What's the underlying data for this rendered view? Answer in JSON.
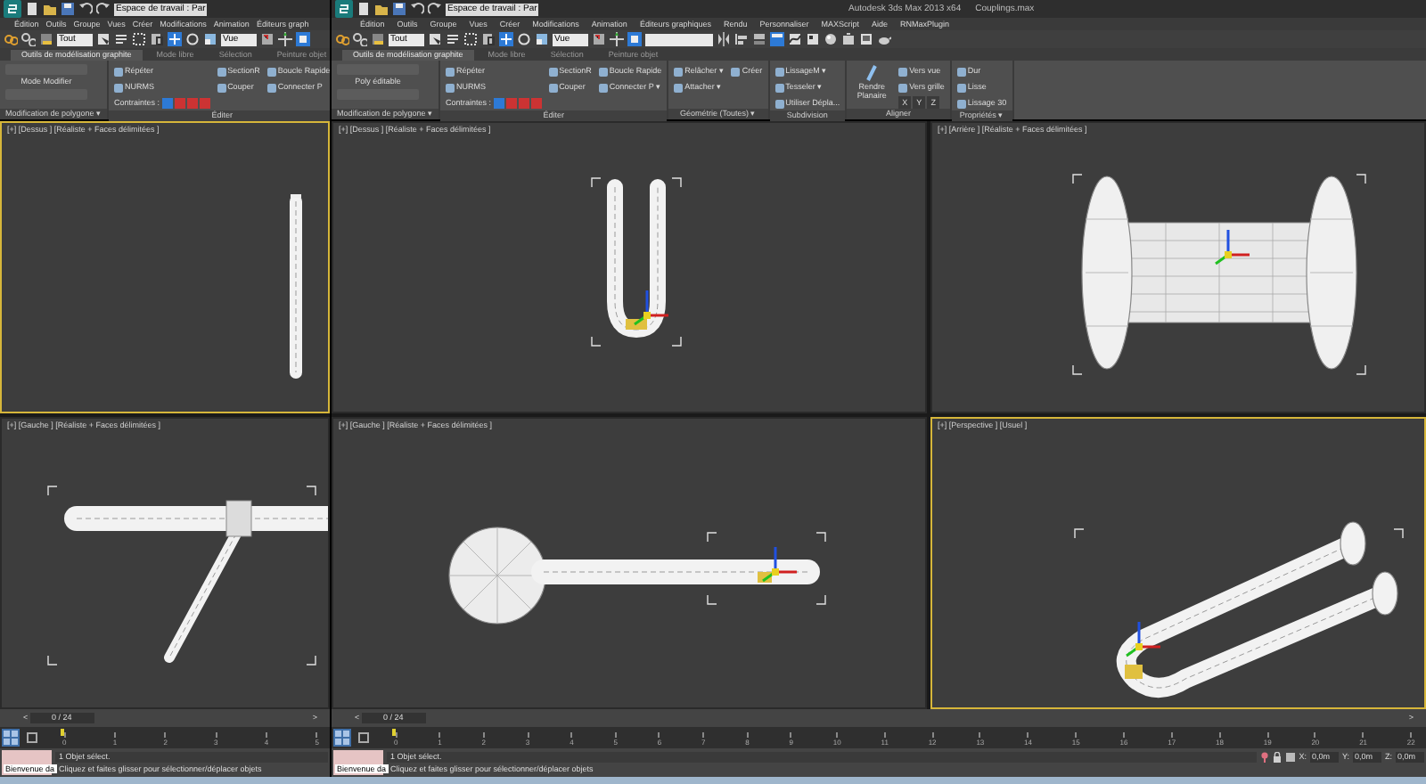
{
  "windows": [
    {
      "kind": "back",
      "workspace": "Espace de travail : Par",
      "menu": [
        "Édition",
        "Outils",
        "Groupe",
        "Vues",
        "Créer",
        "Modifications",
        "Animation",
        "Éditeurs graph"
      ],
      "toolbar": {
        "filter": "Tout",
        "reference": "Vue"
      },
      "ribbon_tabs": [
        {
          "label": "Outils de modélisation graphite",
          "selected": true
        },
        {
          "label": "Mode libre",
          "selected": false
        },
        {
          "label": "Sélection",
          "selected": false
        },
        {
          "label": "Peinture objet",
          "selected": false
        }
      ],
      "ribbon_panels": [
        {
          "footer": "Modification de polygone ▾",
          "columns": [
            [
              {
                "kind": "heading",
                "label": "Mode Modifier"
              }
            ]
          ]
        },
        {
          "footer": "Éditer",
          "columns": [
            [
              {
                "kind": "small",
                "label": "Répéter"
              },
              {
                "kind": "small",
                "label": "NURMS"
              },
              {
                "kind": "constraints",
                "label": "Contraintes :"
              }
            ],
            [
              {
                "kind": "small",
                "label": "SectionR"
              },
              {
                "kind": "small",
                "label": "Couper"
              }
            ],
            [
              {
                "kind": "small",
                "label": "Boucle Rapide"
              },
              {
                "kind": "small",
                "label": "Connecter P"
              }
            ]
          ]
        }
      ],
      "viewports": [
        {
          "label": "[+] [Dessus ] [Réaliste + Faces délimitées ]",
          "active": true,
          "kind": "rod"
        },
        {
          "label": "[+] [Gauche ] [Réaliste + Faces délimitées ]",
          "active": false,
          "kind": "bent_arm"
        }
      ],
      "time_slider": {
        "previous": "<",
        "value": "0 / 24",
        "next": ">"
      },
      "ticks": [
        "0",
        "1",
        "2",
        "3",
        "4",
        "5"
      ],
      "status": {
        "script": "Bienvenue da",
        "selection": "1 Objet sélect.",
        "prompt": "Cliquez et faites glisser pour sélectionner/déplacer objets"
      }
    },
    {
      "kind": "main",
      "workspace": "Espace de travail : Par",
      "title": "Autodesk 3ds Max 2013 x64",
      "file": "Couplings.max",
      "menu": [
        "Édition",
        "Outils",
        "Groupe",
        "Vues",
        "Créer",
        "Modifications",
        "Animation",
        "Éditeurs graphiques",
        "Rendu",
        "Personnaliser",
        "MAXScript",
        "Aide",
        "RNMaxPlugin"
      ],
      "toolbar": {
        "filter": "Tout",
        "reference": "Vue"
      },
      "ribbon_tabs": [
        {
          "label": "Outils de modélisation graphite",
          "selected": true
        },
        {
          "label": "Mode libre",
          "selected": false
        },
        {
          "label": "Sélection",
          "selected": false
        },
        {
          "label": "Peinture objet",
          "selected": false
        }
      ],
      "ribbon_panels": [
        {
          "footer": "Modification de polygone ▾",
          "columns": [
            [
              {
                "kind": "heading",
                "label": "Poly éditable"
              }
            ]
          ]
        },
        {
          "footer": "Éditer",
          "columns": [
            [
              {
                "kind": "small",
                "label": "Répéter"
              },
              {
                "kind": "small",
                "label": "NURMS"
              },
              {
                "kind": "constraints",
                "label": "Contraintes :"
              }
            ],
            [
              {
                "kind": "small",
                "label": "SectionR"
              },
              {
                "kind": "small",
                "label": "Couper"
              }
            ],
            [
              {
                "kind": "small",
                "label": "Boucle Rapide"
              },
              {
                "kind": "small",
                "label": "Connecter P ▾"
              }
            ]
          ]
        },
        {
          "footer": "Géométrie (Toutes) ▾",
          "columns": [
            [
              {
                "kind": "small",
                "label": "Relâcher ▾"
              },
              {
                "kind": "small",
                "label": "Attacher ▾"
              }
            ],
            [
              {
                "kind": "small",
                "label": "Créer"
              }
            ]
          ]
        },
        {
          "footer": "Subdivision",
          "columns": [
            [
              {
                "kind": "small",
                "label": "LissageM ▾"
              },
              {
                "kind": "small",
                "label": "Tesseler ▾"
              },
              {
                "kind": "small",
                "label": "Utiliser Dépla..."
              }
            ]
          ]
        },
        {
          "footer": "Aligner",
          "columns": [
            [
              {
                "kind": "large",
                "label": "Rendre Planaire"
              }
            ],
            [
              {
                "kind": "small",
                "label": "Vers vue"
              },
              {
                "kind": "small",
                "label": "Vers grille"
              },
              {
                "kind": "axes",
                "labels": [
                  "X",
                  "Y",
                  "Z"
                ]
              }
            ]
          ]
        },
        {
          "footer": "Propriétés ▾",
          "columns": [
            [
              {
                "kind": "small",
                "label": "Dur"
              },
              {
                "kind": "small",
                "label": "Lisse"
              },
              {
                "kind": "small",
                "label": "Lissage 30"
              }
            ]
          ]
        }
      ],
      "viewports": [
        {
          "label": "[+] [Dessus ] [Réaliste + Faces délimitées ]",
          "active": false,
          "kind": "u_top"
        },
        {
          "label": "[+] [Arrière ] [Réaliste + Faces délimitées ]",
          "active": false,
          "kind": "barrel"
        },
        {
          "label": "[+] [Gauche ] [Réaliste + Faces délimitées ]",
          "active": false,
          "kind": "arm_disc"
        },
        {
          "label": "[+] [Perspective ] [Usuel ]",
          "active": true,
          "kind": "u_persp"
        }
      ],
      "time_slider": {
        "previous": "<",
        "value": "0 / 24",
        "next": ">"
      },
      "ticks": [
        "0",
        "1",
        "2",
        "3",
        "4",
        "5",
        "6",
        "7",
        "8",
        "9",
        "10",
        "11",
        "12",
        "13",
        "14",
        "15",
        "16",
        "17",
        "18",
        "19",
        "20",
        "21",
        "22"
      ],
      "status": {
        "script": "Bienvenue da",
        "selection": "1 Objet sélect.",
        "prompt": "Cliquez et faites glisser pour sélectionner/déplacer objets",
        "coords": [
          {
            "axis": "X:",
            "value": "0,0m"
          },
          {
            "axis": "Y:",
            "value": "0,0m"
          },
          {
            "axis": "Z:",
            "value": "0,0m"
          }
        ]
      }
    }
  ]
}
